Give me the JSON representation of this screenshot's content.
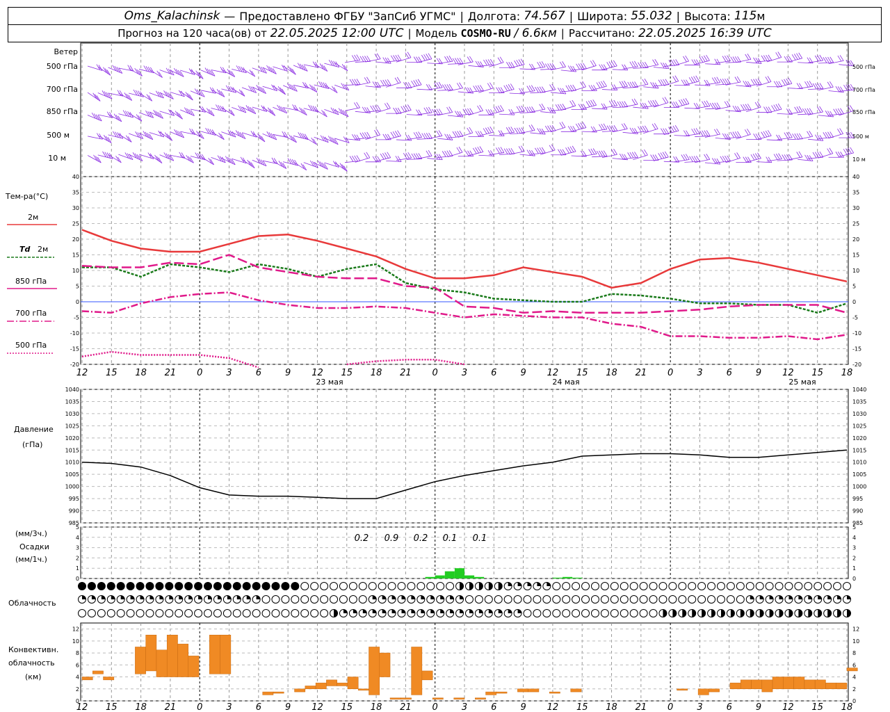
{
  "header": {
    "station": "Oms_Kalachinsk",
    "provider": "Предоставлено ФГБУ \"ЗапСиб УГМС\"",
    "lon_label": "Долгота:",
    "lon": "74.567",
    "lat_label": "Широта:",
    "lat": "55.032",
    "alt_label": "Высота:",
    "alt": "115",
    "alt_unit": "м",
    "forecast_prefix": "Прогноз на 120 часа(ов) от",
    "forecast_start": "22.05.2025 12:00 UTC",
    "model_label": "Модель",
    "model": "COSMO-RU",
    "model_res": "/ 6.6км",
    "computed_label": "Рассчитано:",
    "computed": "22.05.2025 16:39 UTC"
  },
  "labels": {
    "wind": "Ветер",
    "wind_levels": [
      "500 гПа",
      "700 гПа",
      "850 гПа",
      "500 м",
      "10 м"
    ],
    "temp_title": "Тем-ра(°C)",
    "t2m": "2м",
    "td_prefix": "Td",
    "td2m": "2м",
    "t850": "850 гПа",
    "t700": "700 гПа",
    "t500": "500 гПа",
    "pressure_title": "Давление",
    "pressure_unit": "(гПа)",
    "precip_unit3": "(мм/3ч.)",
    "precip_title": "Осадки",
    "precip_unit1": "(мм/1ч.)",
    "cloud_title": "Облачность",
    "conv_title1": "Конвективн.",
    "conv_title2": "облачность",
    "conv_unit": "(км)"
  },
  "colors": {
    "t2m": "#e8393a",
    "td2m": "#1a7a1a",
    "t850": "#e0198a",
    "t700": "#e0198a",
    "t500": "#e0198a",
    "wind": "#8a2be2",
    "pressure": "#000000",
    "precip": "#22cc22",
    "convective": "#f08a24"
  },
  "chart_data": [
    {
      "type": "line",
      "title": "Тем-ра(°C)",
      "x": [
        "12",
        "15",
        "18",
        "21",
        "0",
        "3",
        "6",
        "9",
        "12",
        "15",
        "18",
        "21",
        "0",
        "3",
        "6",
        "9",
        "12",
        "15",
        "18",
        "21",
        "0",
        "3",
        "6",
        "9",
        "12",
        "15",
        "18"
      ],
      "day_labels": [
        "23 мая",
        "24 мая",
        "25 мая"
      ],
      "ylim": [
        -20,
        40
      ],
      "series": [
        {
          "name": "2м",
          "values": [
            23,
            19.5,
            17,
            16,
            16,
            18.5,
            21,
            21.5,
            19.5,
            17,
            14.5,
            10.5,
            7.5,
            7.5,
            8.5,
            11,
            9.5,
            8,
            4.5,
            6,
            10.5,
            13.5,
            14,
            12.5,
            10.5,
            8.5,
            6.5
          ]
        },
        {
          "name": "Td 2м",
          "values": [
            11,
            11,
            8,
            12,
            11,
            9.5,
            12,
            10.5,
            8,
            10.5,
            12,
            6,
            4,
            3,
            1,
            0.5,
            0,
            0,
            2.5,
            2,
            1,
            -0.5,
            -0.5,
            -1,
            -1,
            -3.5,
            -0.5
          ]
        },
        {
          "name": "850 гПа",
          "values": [
            11.5,
            11,
            11,
            12.5,
            12,
            15,
            11,
            9.5,
            8,
            7.5,
            7.5,
            5,
            4.5,
            -1.5,
            -2,
            -3.5,
            -3,
            -3.5,
            -3.5,
            -3.5,
            -3,
            -2.5,
            -1.5,
            -1,
            -1,
            -1,
            -3.5
          ]
        },
        {
          "name": "700 гПа",
          "values": [
            -3,
            -3.5,
            -0.5,
            1.5,
            2.5,
            3,
            0.5,
            -1,
            -2,
            -2,
            -1.5,
            -2,
            -3.5,
            -5,
            -4,
            -4.5,
            -5,
            -5,
            -7,
            -8,
            -11,
            -11,
            -11.5,
            -11.5,
            -11,
            -12,
            -10.5
          ]
        },
        {
          "name": "500 гПа",
          "values": [
            -17.5,
            -16,
            -17,
            -17,
            -17,
            -18,
            -21,
            null,
            null,
            -20,
            -19,
            -18.5,
            -18.5,
            -20,
            null,
            null,
            null,
            null,
            null,
            null,
            null,
            null,
            null,
            null,
            null,
            null,
            null
          ]
        }
      ]
    },
    {
      "type": "line",
      "title": "Давление",
      "ylabel": "(гПа)",
      "ylim": [
        985,
        1040
      ],
      "x": [
        "12",
        "15",
        "18",
        "21",
        "0",
        "3",
        "6",
        "9",
        "12",
        "15",
        "18",
        "21",
        "0",
        "3",
        "6",
        "9",
        "12",
        "15",
        "18",
        "21",
        "0",
        "3",
        "6",
        "9",
        "12",
        "15",
        "18"
      ],
      "series": [
        {
          "name": "Давление",
          "values": [
            1010,
            1009.5,
            1008,
            1004.5,
            999.5,
            996.5,
            996,
            996,
            995.5,
            995,
            995,
            998.5,
            1002,
            1004.5,
            1006.5,
            1008.5,
            1010,
            1012.5,
            1013,
            1013.5,
            1013.5,
            1013,
            1012,
            1012,
            1013,
            1014,
            1015
          ]
        }
      ]
    },
    {
      "type": "bar",
      "title": "Осадки",
      "ylim": [
        0,
        5
      ],
      "totals": [
        {
          "time": "15",
          "value": "0.2"
        },
        {
          "time": "18",
          "value": "0.9"
        },
        {
          "time": "21",
          "value": "0.2"
        },
        {
          "time": "0",
          "value": "0.1"
        },
        {
          "time": "3",
          "value": "0.1"
        }
      ]
    },
    {
      "type": "bar",
      "title": "Конвективн. облачность",
      "ylabel": "(км)",
      "ylim": [
        0,
        13
      ],
      "yticks": [
        0,
        2,
        4,
        6,
        8,
        10,
        12
      ],
      "spans": [
        [
          0,
          3.5,
          4
        ],
        [
          1,
          4.5,
          5
        ],
        [
          2,
          3.5,
          4
        ],
        [
          5,
          4.5,
          9
        ],
        [
          6,
          5,
          11
        ],
        [
          7,
          4,
          8.5
        ],
        [
          8,
          4,
          11
        ],
        [
          9,
          4,
          9.5
        ],
        [
          10,
          4,
          7.5
        ],
        [
          12,
          4.5,
          11
        ],
        [
          13,
          4.5,
          11
        ],
        [
          17,
          1,
          1.5
        ],
        [
          18,
          1.5,
          1.5
        ],
        [
          20,
          1.5,
          2
        ],
        [
          21,
          2,
          2.5
        ],
        [
          22,
          2,
          3
        ],
        [
          23,
          2.5,
          3.5
        ],
        [
          24,
          2.5,
          3
        ],
        [
          25,
          2,
          4
        ],
        [
          26,
          2,
          2
        ],
        [
          27,
          1,
          9
        ],
        [
          28,
          4,
          8
        ],
        [
          29,
          0.5,
          0.5
        ],
        [
          30,
          0.5,
          0.5
        ],
        [
          31,
          1,
          9
        ],
        [
          32,
          3.5,
          5
        ],
        [
          33,
          0.5,
          0.5
        ],
        [
          35,
          0.5,
          0.5
        ],
        [
          37,
          0.5,
          0.5
        ],
        [
          38,
          1,
          1.5
        ],
        [
          39,
          1.5,
          1.5
        ],
        [
          41,
          1.5,
          2
        ],
        [
          42,
          1.5,
          2
        ],
        [
          44,
          1.5,
          1.5
        ],
        [
          46,
          1.5,
          2
        ],
        [
          56,
          2,
          2
        ],
        [
          58,
          1,
          2
        ],
        [
          59,
          1.5,
          2
        ],
        [
          61,
          2,
          3
        ],
        [
          62,
          2,
          3.5
        ],
        [
          63,
          2,
          3.5
        ],
        [
          64,
          1.5,
          3.5
        ],
        [
          65,
          2,
          4
        ],
        [
          66,
          2,
          4
        ],
        [
          67,
          2,
          4
        ],
        [
          68,
          2,
          3.5
        ],
        [
          69,
          2,
          3.5
        ],
        [
          70,
          2,
          3
        ],
        [
          71,
          2,
          3
        ],
        [
          72,
          5,
          5.5
        ]
      ]
    }
  ],
  "cloud_rows": {
    "row1": "dddddddddddddddddddddddoooooooooooooooopppppqqqqqoooooooooooooooooooooooooooooooooooooooooooooooooooooooooooooq",
    "row2": "qqqqqqqqqqqqqqqqqqqoooooooooooqqqqqqqqqqoooooooooooooooooooooooooooooqqqqqqqqqqqqqqqqqqqqqq",
    "row3": "oooooooooooooooooooooooooopqqqqqqqqqqqqqqqqqqqoooooooooooooopppppppppppppppppppppppppppppq"
  }
}
